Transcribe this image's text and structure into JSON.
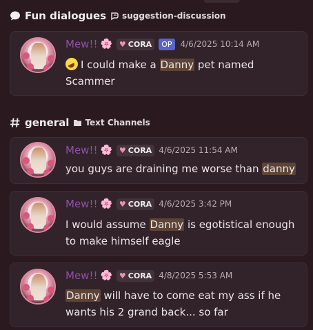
{
  "thread_section": {
    "title": "Fun dialogues",
    "subtitle": "suggestion-discussion",
    "icon": "speech-bubble-icon",
    "sub_icon": "thread-icon"
  },
  "channel_section": {
    "title": "general",
    "subtitle": "Text Channels",
    "icon": "hash-icon",
    "sub_icon": "folder-icon"
  },
  "messages": [
    {
      "author": "Mew!!",
      "author_emoji": "🌸",
      "tag": "CORA",
      "op": "OP",
      "timestamp": "4/6/2025 10:14 AM",
      "pre": "I could make a ",
      "highlight": "Danny",
      "post": " pet named Scammer"
    },
    {
      "author": "Mew!!",
      "author_emoji": "🌸",
      "tag": "CORA",
      "timestamp": "4/6/2025 11:54 AM",
      "pre": "you guys are draining me worse than ",
      "highlight": "danny",
      "post": ""
    },
    {
      "author": "Mew!!",
      "author_emoji": "🌸",
      "tag": "CORA",
      "timestamp": "4/6/2025 3:42 PM",
      "pre": "I would assume ",
      "highlight": "Danny",
      "post": " is egotistical enough to make himself eagle"
    },
    {
      "author": "Mew!!",
      "author_emoji": "🌸",
      "tag": "CORA",
      "timestamp": "4/8/2025 5:53 AM",
      "pre": "",
      "highlight": "Danny",
      "post": " will have to come eat my ass if he wants his 2 grand back... so far"
    }
  ],
  "colors": {
    "background": "#2a1a1f",
    "card": "#32232a",
    "author": "#8c50a6",
    "highlight": "#5e4435",
    "op_badge": "#5865c7"
  }
}
